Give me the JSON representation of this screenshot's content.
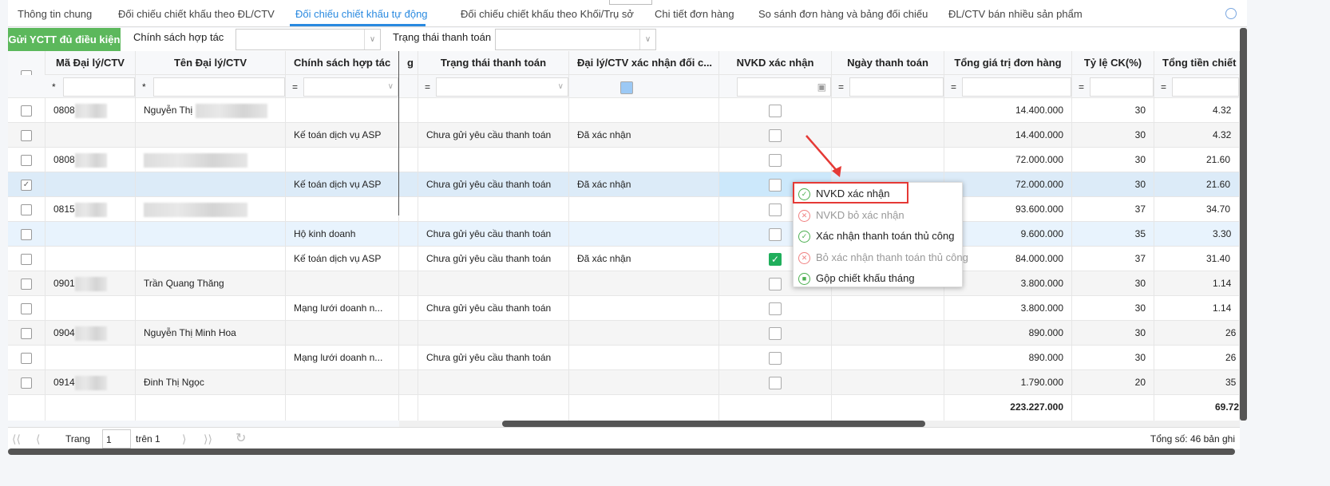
{
  "tabs": [
    {
      "label": "Thông tin chung"
    },
    {
      "label": "Đối chiếu chiết khấu theo ĐL/CTV"
    },
    {
      "label": "Đối chiếu chiết khấu tự động",
      "active": true
    },
    {
      "label": "Đối chiếu chiết khấu theo Khối/Trụ sở"
    },
    {
      "label": "Chi tiết đơn hàng"
    },
    {
      "label": "So sánh đơn hàng và bảng đối chiếu"
    },
    {
      "label": "ĐL/CTV bán nhiều sản phẩm"
    }
  ],
  "toolbar": {
    "send_label": "Gửi YCTT đủ điều kiện",
    "policy_label": "Chính sách hợp tác",
    "status_label": "Trạng thái thanh toán",
    "policy_value": "",
    "status_value": ""
  },
  "columns": [
    "Mã Đại lý/CTV",
    "Tên Đại lý/CTV",
    "Chính sách hợp tác",
    "g",
    "Trạng thái thanh toán",
    "Đại lý/CTV xác nhận đối c...",
    "NVKD xác nhận",
    "Ngày thanh toán",
    "Tổng giá trị đơn hàng",
    "Tỷ lệ CK(%)",
    "Tổng tiền chiết k"
  ],
  "filters": [
    "*",
    "*",
    "=",
    "",
    "=",
    "=",
    "",
    "=",
    "=",
    "=",
    "="
  ],
  "rows": [
    {
      "code": "0808",
      "name": "Nguyễn Thị",
      "policy": "",
      "status": "",
      "agent": "",
      "nvkd": false,
      "total": "14.400.000",
      "rate": "30",
      "disc": "4.32"
    },
    {
      "code": "",
      "name": "",
      "policy": "Kế toán dịch vụ ASP",
      "status": "Chưa gửi yêu cầu thanh toán",
      "agent": "Đã xác nhận",
      "nvkd": false,
      "total": "14.400.000",
      "rate": "30",
      "disc": "4.32"
    },
    {
      "code": "0808",
      "name": "",
      "policy": "",
      "status": "",
      "agent": "",
      "nvkd": false,
      "total": "72.000.000",
      "rate": "30",
      "disc": "21.60"
    },
    {
      "code": "",
      "name": "",
      "policy": "Kế toán dịch vụ ASP",
      "status": "Chưa gửi yêu cầu thanh toán",
      "agent": "Đã xác nhận",
      "nvkd": false,
      "total": "72.000.000",
      "rate": "30",
      "disc": "21.60",
      "selected": true
    },
    {
      "code": "0815",
      "name": "",
      "policy": "",
      "status": "",
      "agent": "",
      "nvkd": false,
      "total": "93.600.000",
      "rate": "37",
      "disc": "34.70"
    },
    {
      "code": "",
      "name": "",
      "policy": "Hộ kinh doanh",
      "status": "Chưa gửi yêu cầu thanh toán",
      "agent": "",
      "nvkd": false,
      "total": "9.600.000",
      "rate": "35",
      "disc": "3.30",
      "hover": true
    },
    {
      "code": "",
      "name": "",
      "policy": "Kế toán dịch vụ ASP",
      "status": "Chưa gửi yêu cầu thanh toán",
      "agent": "Đã xác nhận",
      "nvkd": true,
      "total": "84.000.000",
      "rate": "37",
      "disc": "31.40"
    },
    {
      "code": "0901",
      "name": "Trần Quang Thăng",
      "policy": "",
      "status": "",
      "agent": "",
      "nvkd": false,
      "total": "3.800.000",
      "rate": "30",
      "disc": "1.14"
    },
    {
      "code": "",
      "name": "",
      "policy": "Mạng lưới doanh n...",
      "status": "Chưa gửi yêu cầu thanh toán",
      "agent": "",
      "nvkd": false,
      "total": "3.800.000",
      "rate": "30",
      "disc": "1.14"
    },
    {
      "code": "0904",
      "name": "Nguyễn Thị Minh Hoa",
      "policy": "",
      "status": "",
      "agent": "",
      "nvkd": false,
      "total": "890.000",
      "rate": "30",
      "disc": "26"
    },
    {
      "code": "",
      "name": "",
      "policy": "Mạng lưới doanh n...",
      "status": "Chưa gửi yêu cầu thanh toán",
      "agent": "",
      "nvkd": false,
      "total": "890.000",
      "rate": "30",
      "disc": "26"
    },
    {
      "code": "0914",
      "name": "Đinh Thị Ngọc",
      "policy": "",
      "status": "",
      "agent": "",
      "nvkd": false,
      "total": "1.790.000",
      "rate": "20",
      "disc": "35"
    }
  ],
  "summary": {
    "total": "223.227.000",
    "disc": "69.72"
  },
  "context_menu": [
    {
      "label": "NVKD xác nhận",
      "enabled": true,
      "icon": "check-circle-icon"
    },
    {
      "label": "NVKD bỏ xác nhận",
      "enabled": false,
      "icon": "x-circle-icon"
    },
    {
      "label": "Xác nhận thanh toán thủ công",
      "enabled": true,
      "icon": "check-circle-icon"
    },
    {
      "label": "Bỏ xác nhận thanh toán thủ công",
      "enabled": false,
      "icon": "x-circle-icon"
    },
    {
      "label": "Gộp chiết khấu tháng",
      "enabled": true,
      "icon": "merge-icon"
    }
  ],
  "pager": {
    "page_label": "Trang",
    "page": "1",
    "of_label": "trên 1",
    "total": "Tổng số: 46 bản ghi"
  },
  "colors": {
    "accent": "#2a8ae0",
    "send": "#5cb85c",
    "selected": "#dcebf8",
    "highlight": "#e53935"
  }
}
